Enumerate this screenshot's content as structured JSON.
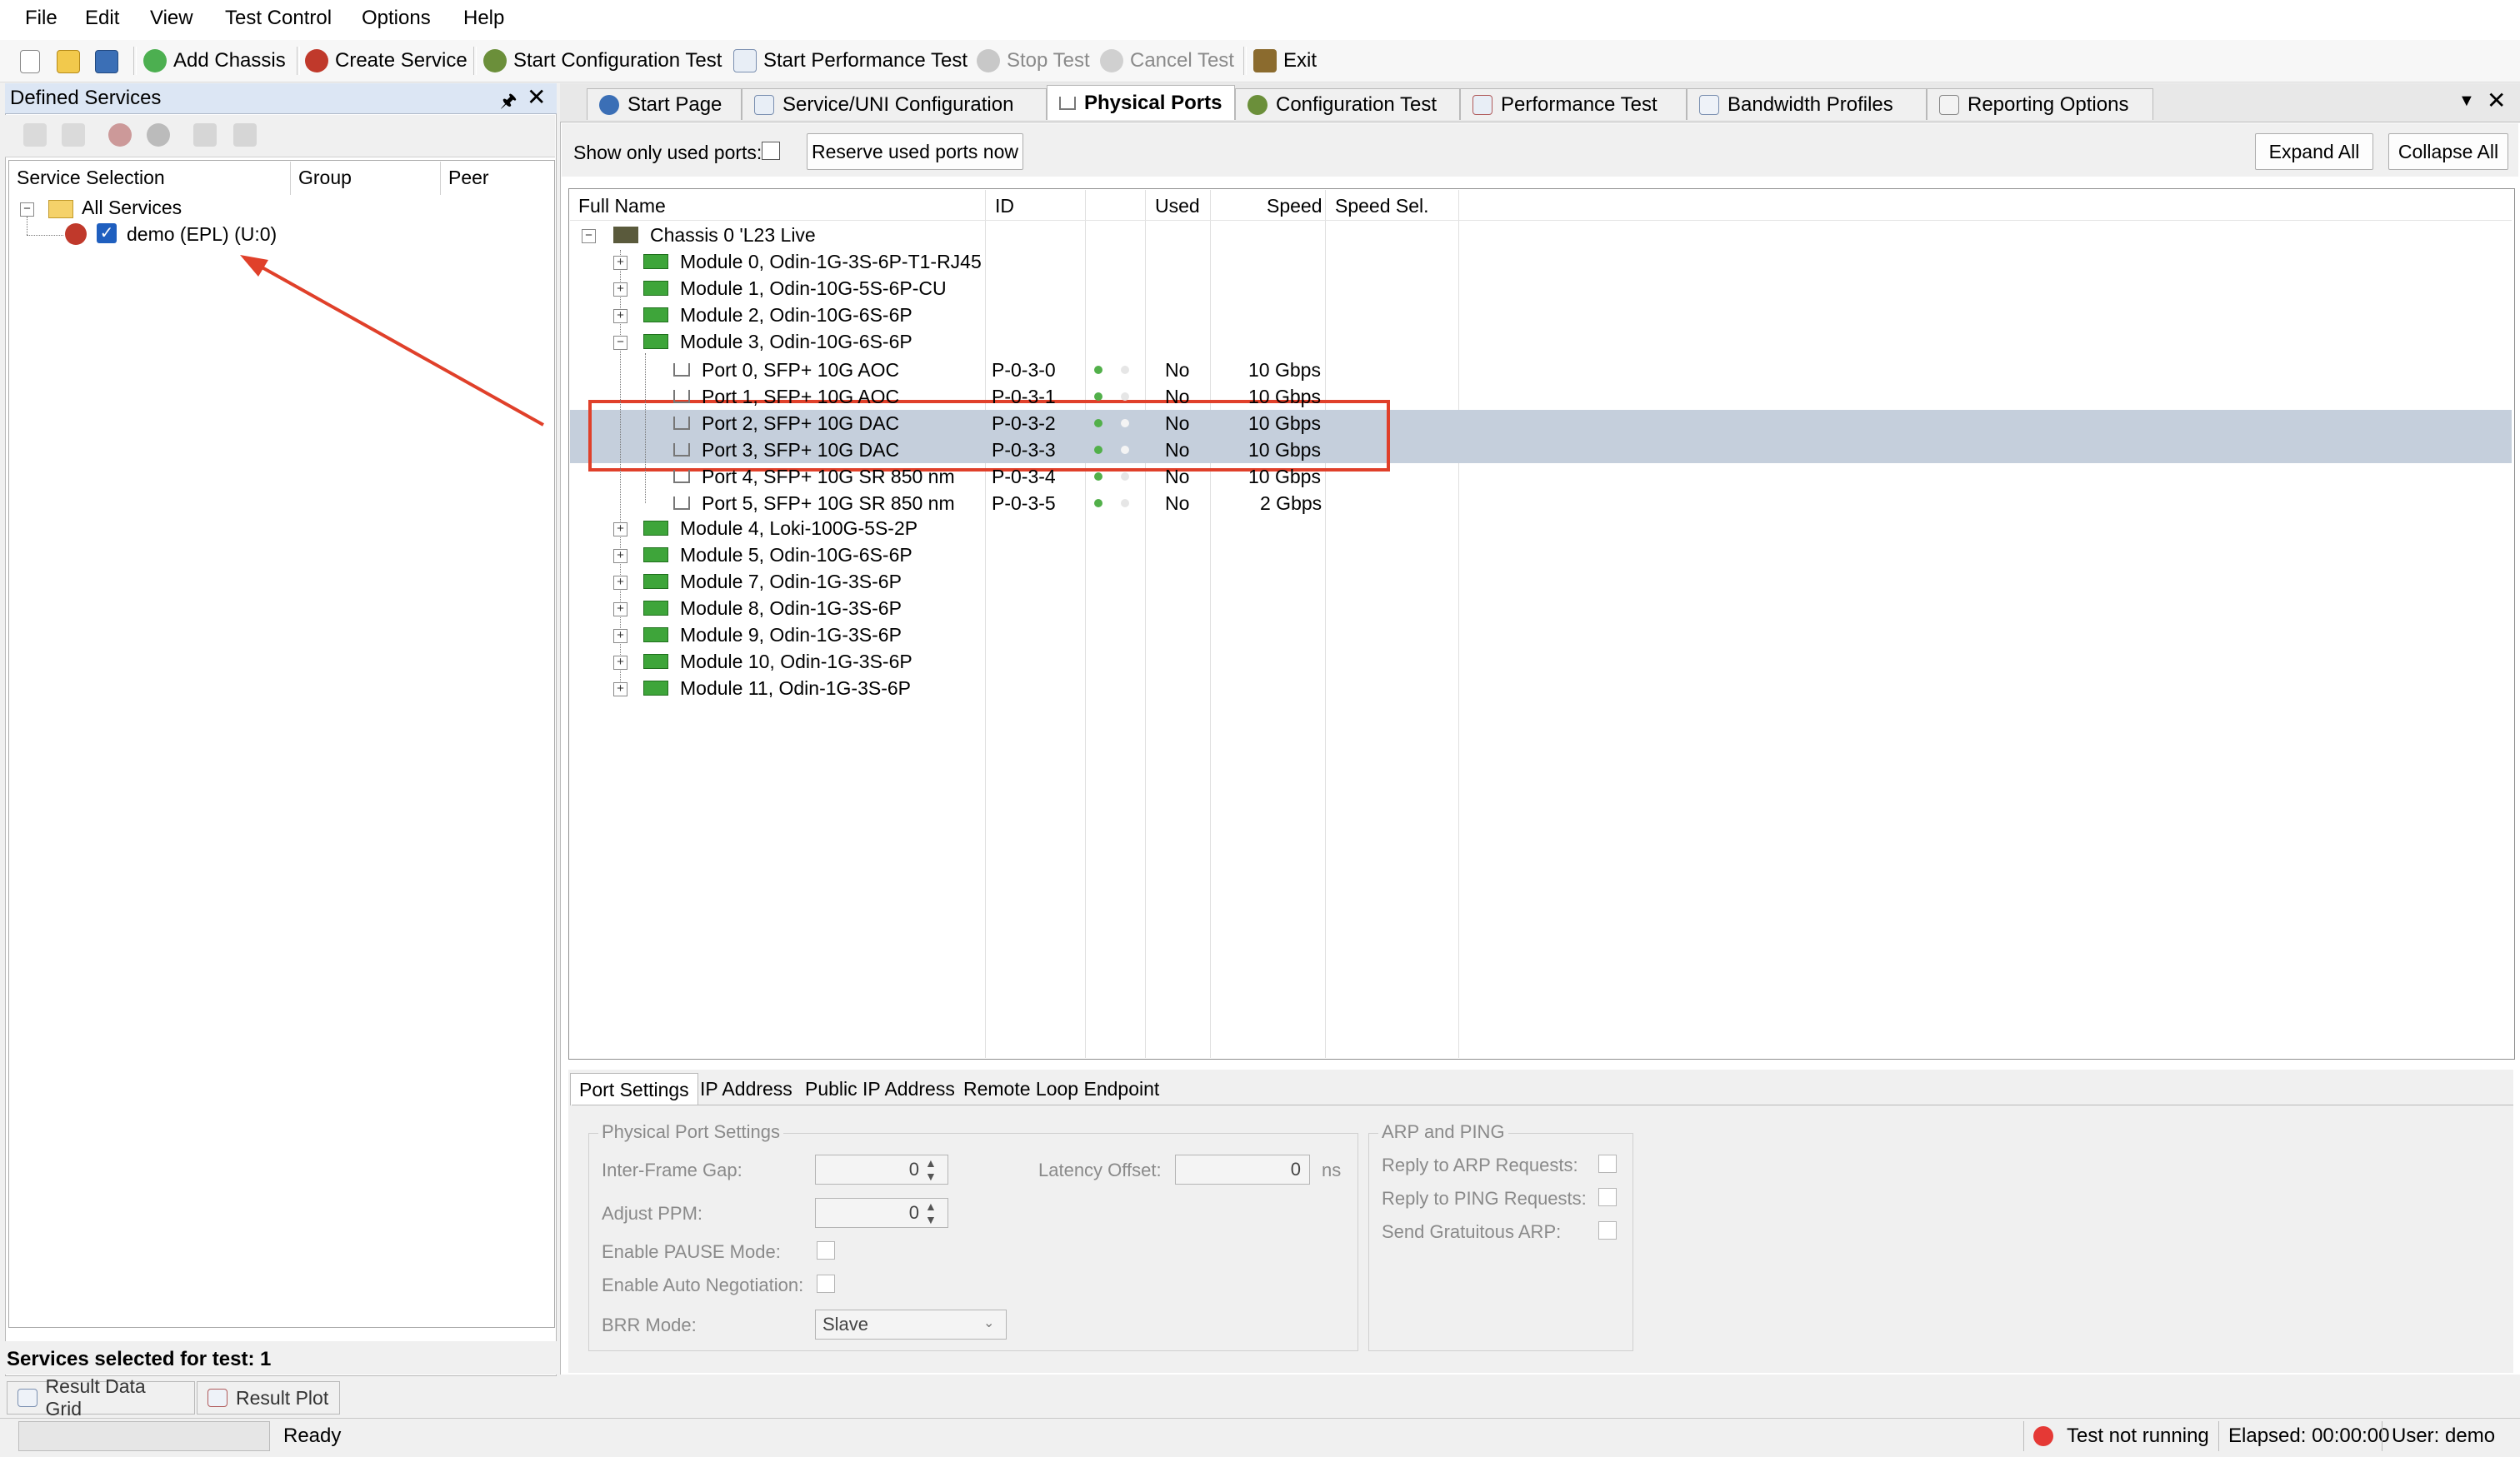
{
  "menu": [
    "File",
    "Edit",
    "View",
    "Test Control",
    "Options",
    "Help"
  ],
  "toolbar": {
    "add_chassis": "Add Chassis",
    "create_service": "Create Service",
    "start_config": "Start Configuration Test",
    "start_perf": "Start Performance Test",
    "stop": "Stop Test",
    "cancel": "Cancel Test",
    "exit": "Exit"
  },
  "left_panel": {
    "title": "Defined Services",
    "columns": [
      "Service Selection",
      "Group",
      "Peer"
    ],
    "root": "All Services",
    "service": "demo (EPL) (U:0)",
    "selected_label": "Services selected for test:",
    "selected_count": "1"
  },
  "tabs": [
    "Start Page",
    "Service/UNI Configuration",
    "Physical Ports",
    "Configuration Test",
    "Performance Test",
    "Bandwidth Profiles",
    "Reporting Options"
  ],
  "ports_view": {
    "show_used_label": "Show only used ports:",
    "reserve_button": "Reserve used ports now",
    "expand_all": "Expand All",
    "collapse_all": "Collapse All",
    "columns": [
      "Full Name",
      "ID",
      "Used",
      "Speed",
      "Speed Sel."
    ],
    "chassis": "Chassis 0 'L23 Live",
    "modules_before": [
      "Module 0, Odin-1G-3S-6P-T1-RJ45",
      "Module 1, Odin-10G-5S-6P-CU",
      "Module 2, Odin-10G-6S-6P",
      "Module 3, Odin-10G-6S-6P"
    ],
    "ports": [
      {
        "name": "Port 0, SFP+ 10G AOC",
        "id": "P-0-3-0",
        "used": "No",
        "speed": "10 Gbps"
      },
      {
        "name": "Port 1, SFP+ 10G AOC",
        "id": "P-0-3-1",
        "used": "No",
        "speed": "10 Gbps"
      },
      {
        "name": "Port 2, SFP+ 10G DAC",
        "id": "P-0-3-2",
        "used": "No",
        "speed": "10 Gbps"
      },
      {
        "name": "Port 3, SFP+ 10G DAC",
        "id": "P-0-3-3",
        "used": "No",
        "speed": "10 Gbps"
      },
      {
        "name": "Port 4, SFP+ 10G SR 850 nm",
        "id": "P-0-3-4",
        "used": "No",
        "speed": "10 Gbps"
      },
      {
        "name": "Port 5, SFP+ 10G SR 850 nm",
        "id": "P-0-3-5",
        "used": "No",
        "speed": "2 Gbps"
      }
    ],
    "modules_after": [
      "Module 4, Loki-100G-5S-2P",
      "Module 5, Odin-10G-6S-6P",
      "Module 7, Odin-1G-3S-6P",
      "Module 8, Odin-1G-3S-6P",
      "Module 9, Odin-1G-3S-6P",
      "Module 10, Odin-1G-3S-6P",
      "Module 11, Odin-1G-3S-6P"
    ]
  },
  "bottom_tabs": [
    "Port Settings",
    "IP Address",
    "Public IP Address",
    "Remote Loop Endpoint"
  ],
  "port_settings": {
    "group1": "Physical Port Settings",
    "ifg_label": "Inter-Frame Gap:",
    "ifg_value": "0",
    "ppm_label": "Adjust PPM:",
    "ppm_value": "0",
    "pause_label": "Enable PAUSE Mode:",
    "autoneg_label": "Enable Auto Negotiation:",
    "brr_label": "BRR Mode:",
    "brr_value": "Slave",
    "latency_label": "Latency Offset:",
    "latency_value": "0",
    "latency_unit": "ns",
    "group2": "ARP and PING",
    "arp_label": "Reply to ARP Requests:",
    "ping_label": "Reply to PING Requests:",
    "garp_label": "Send Gratuitous ARP:"
  },
  "result_tabs": [
    "Result Data Grid",
    "Result Plot"
  ],
  "status": {
    "ready": "Ready",
    "test_state": "Test not running",
    "elapsed": "Elapsed: 00:00:00",
    "user": "User: demo"
  },
  "colors": {
    "highlight_row": "#c5cfdc",
    "annotation": "#e0402a",
    "module_green": "#3ea53a"
  }
}
